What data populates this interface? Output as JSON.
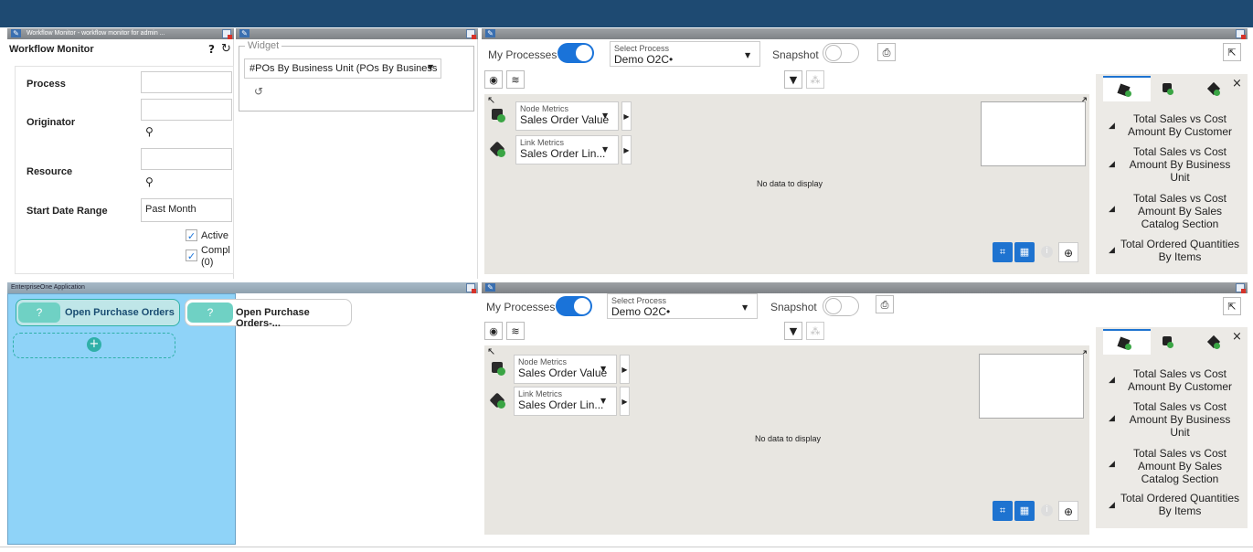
{
  "panels": {
    "workflow": {
      "title_bar": "Workflow Monitor - workflow monitor for admin ...",
      "heading": "Workflow Monitor",
      "help_glyph": "?",
      "refresh_glyph": "↻",
      "labels": {
        "process": "Process",
        "originator": "Originator",
        "resource": "Resource",
        "start_date": "Start Date Range"
      },
      "start_date_value": "Past Month",
      "checkboxes": [
        {
          "label": "Active",
          "checked": true
        },
        {
          "label": "Compl",
          "sub": "(0)",
          "checked": true
        }
      ]
    },
    "widget": {
      "legend": "Widget",
      "select_value": "#POs By Business Unit (POs By Business ..."
    },
    "enterprise": {
      "title_bar": "EnterpriseOne Application",
      "buttons": [
        {
          "q": "?",
          "label": "Open Purchase Orders"
        },
        {
          "q": "?",
          "label": "Open Purchase Orders-..."
        }
      ],
      "add_glyph": "+"
    },
    "process_top": {
      "my_processes": "My Processes",
      "select_process_label": "Select Process",
      "select_process_value": "Demo O2C•",
      "snapshot": "Snapshot",
      "node_metrics_label": "Node Metrics",
      "node_metrics_value": "Sales Order Value",
      "link_metrics_label": "Link Metrics",
      "link_metrics_value": "Sales Order Lin...",
      "no_data": "No data to display",
      "side_items": [
        "Total Sales vs Cost Amount By Customer",
        "Total Sales vs Cost Amount By Business Unit",
        "Total Sales vs Cost Amount By Sales Catalog Section",
        "Total Ordered Quantities By Items"
      ],
      "close_glyph": "×"
    },
    "process_bottom": {
      "my_processes": "My Processes",
      "select_process_label": "Select Process",
      "select_process_value": "Demo O2C•",
      "snapshot": "Snapshot",
      "node_metrics_label": "Node Metrics",
      "node_metrics_value": "Sales Order Value",
      "link_metrics_label": "Link Metrics",
      "link_metrics_value": "Sales Order Lin...",
      "no_data": "No data to display",
      "side_items": [
        "Total Sales vs Cost Amount By Customer",
        "Total Sales vs Cost Amount By Business Unit",
        "Total Sales vs Cost Amount By Sales Catalog Section",
        "Total Ordered Quantities By Items"
      ],
      "close_glyph": "×"
    }
  },
  "colors": {
    "topbar": "#1e4a72",
    "accent": "#1a73d9",
    "highlight": "#8fd3f8",
    "teal": "#2fb0a8"
  }
}
